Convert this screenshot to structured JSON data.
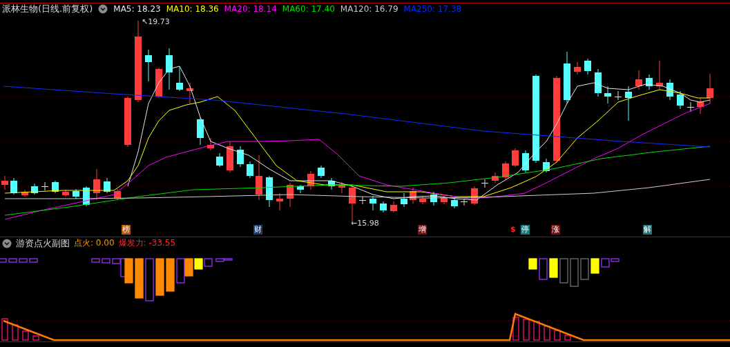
{
  "title": "派林生物(日线.前复权)",
  "indicators": [
    {
      "label": "MA5: 18.23",
      "color": "#e8e8e8"
    },
    {
      "label": "MA10: 18.36",
      "color": "#ffff00"
    },
    {
      "label": "MA20: 18.14",
      "color": "#ff00ff"
    },
    {
      "label": "MA60: 17.40",
      "color": "#00e000"
    },
    {
      "label": "MA120: 16.79",
      "color": "#c8c8c8"
    },
    {
      "label": "MA250: 17.38",
      "color": "#0030ff"
    }
  ],
  "price_labels": [
    {
      "text": "↖19.73"
    },
    {
      "text": "←15.98"
    }
  ],
  "events": [
    {
      "text": "榜",
      "color": "#b05a10"
    },
    {
      "text": "财",
      "color": "#1c3c70"
    },
    {
      "text": "增",
      "color": "#7a1010"
    },
    {
      "text": "$",
      "color": "#000000"
    },
    {
      "text": "停",
      "color": "#167a7a"
    },
    {
      "text": "涨",
      "color": "#7a1010"
    },
    {
      "text": "解",
      "color": "#167a7a"
    }
  ],
  "subchart": {
    "title": "游资点火副图",
    "readings": [
      {
        "label": "点火: 0.00",
        "color": "#ff9a00"
      },
      {
        "label": "爆发力: -33.55",
        "color": "#ff2a2a"
      }
    ]
  }
}
